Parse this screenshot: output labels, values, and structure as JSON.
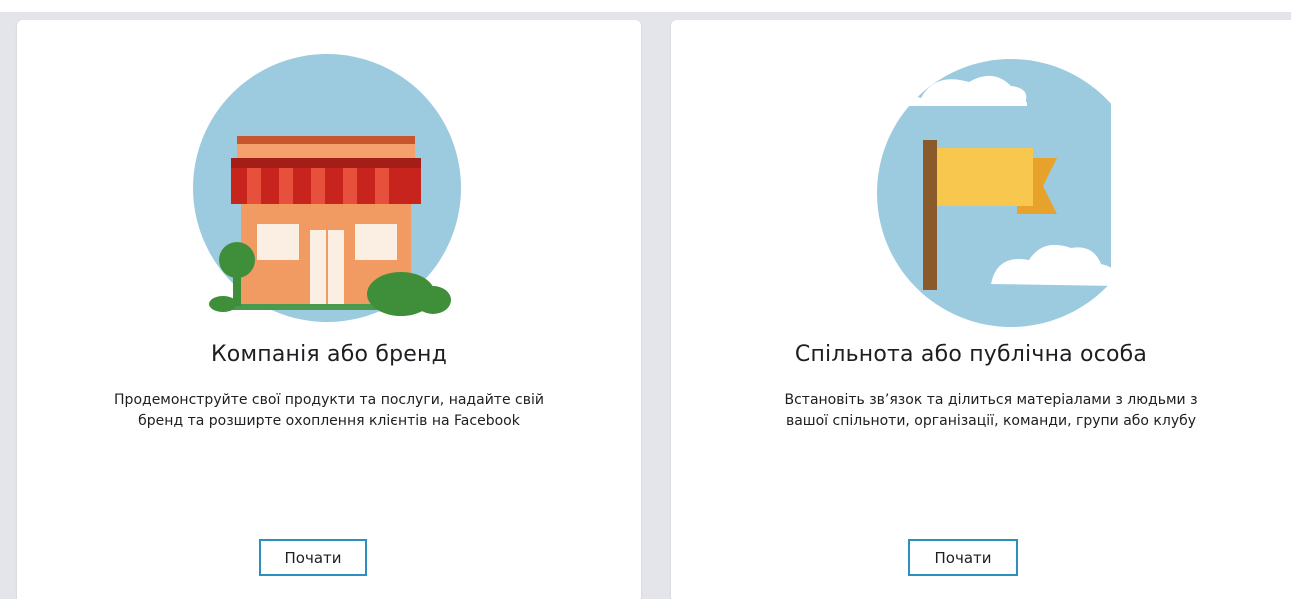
{
  "cards": [
    {
      "title": "Компанія або бренд",
      "description_line1": "Продемонструйте свої продукти та послуги, надайте свій",
      "description_line2": "бренд та розширте охоплення клієнтів на Facebook",
      "button_label": "Почати",
      "illustration": "storefront-icon"
    },
    {
      "title": "Спільнота або публічна особа",
      "description_line1": "Встановіть зв’язок та ділиться матеріалами з людьми з",
      "description_line2": "вашої спільноти, організації, команди, групи або клубу",
      "button_label": "Почати",
      "illustration": "flag-icon"
    }
  ],
  "colors": {
    "background": "#e3e5ea",
    "card": "#ffffff",
    "button_border": "#2b8fbf",
    "circle": "#9ccbe0"
  }
}
